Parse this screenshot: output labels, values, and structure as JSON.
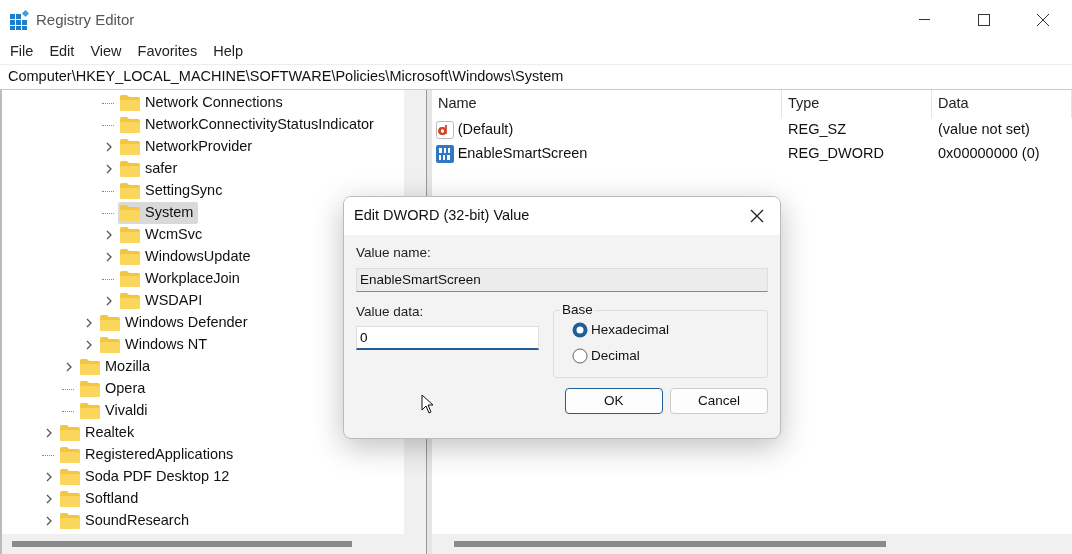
{
  "window": {
    "title": "Registry Editor"
  },
  "menu": [
    "File",
    "Edit",
    "View",
    "Favorites",
    "Help"
  ],
  "address": "Computer\\HKEY_LOCAL_MACHINE\\SOFTWARE\\Policies\\Microsoft\\Windows\\System",
  "tree": [
    {
      "children": [
        {
          "children": [
            {
              "children": [
                {
                  "label": "Network Connections",
                  "expandable": false,
                  "selected": false
                },
                {
                  "label": "NetworkConnectivityStatusIndicator",
                  "expandable": false,
                  "selected": false
                },
                {
                  "label": "NetworkProvider",
                  "expandable": true,
                  "selected": false
                },
                {
                  "label": "safer",
                  "expandable": true,
                  "selected": false
                },
                {
                  "label": "SettingSync",
                  "expandable": false,
                  "selected": false
                },
                {
                  "label": "System",
                  "expandable": false,
                  "selected": true
                },
                {
                  "label": "WcmSvc",
                  "expandable": true,
                  "selected": false
                },
                {
                  "label": "WindowsUpdate",
                  "expandable": true,
                  "selected": false
                },
                {
                  "label": "WorkplaceJoin",
                  "expandable": false,
                  "selected": false
                },
                {
                  "label": "WSDAPI",
                  "expandable": true,
                  "selected": false
                }
              ]
            },
            {
              "label": "Windows Defender",
              "expandable": true,
              "selected": false
            },
            {
              "label": "Windows NT",
              "expandable": true,
              "selected": false
            }
          ]
        },
        {
          "label": "Mozilla",
          "expandable": true,
          "selected": false
        },
        {
          "label": "Opera",
          "expandable": false,
          "selected": false
        },
        {
          "label": "Vivaldi",
          "expandable": false,
          "selected": false
        }
      ]
    },
    {
      "label": "Realtek",
      "expandable": true,
      "selected": false
    },
    {
      "label": "RegisteredApplications",
      "expandable": false,
      "selected": false
    },
    {
      "label": "Soda PDF Desktop 12",
      "expandable": true,
      "selected": false
    },
    {
      "label": "Softland",
      "expandable": true,
      "selected": false
    },
    {
      "label": "SoundResearch",
      "expandable": true,
      "selected": false
    }
  ],
  "values": {
    "columns": [
      "Name",
      "Type",
      "Data"
    ],
    "rows": [
      {
        "kind": "string",
        "name": "(Default)",
        "type": "REG_SZ",
        "data": "(value not set)"
      },
      {
        "kind": "dword",
        "name": "EnableSmartScreen",
        "type": "REG_DWORD",
        "data": "0x00000000 (0)"
      }
    ]
  },
  "dialog": {
    "title": "Edit DWORD (32-bit) Value",
    "value_name_label": "Value name:",
    "value_name": "EnableSmartScreen",
    "value_data_label": "Value data:",
    "value_data": "0",
    "base_label": "Base",
    "bases": [
      {
        "label": "Hexadecimal",
        "selected": true
      },
      {
        "label": "Decimal",
        "selected": false
      }
    ],
    "buttons": [
      {
        "label": "OK",
        "kind": "default"
      },
      {
        "label": "Cancel",
        "kind": "normal"
      }
    ]
  }
}
